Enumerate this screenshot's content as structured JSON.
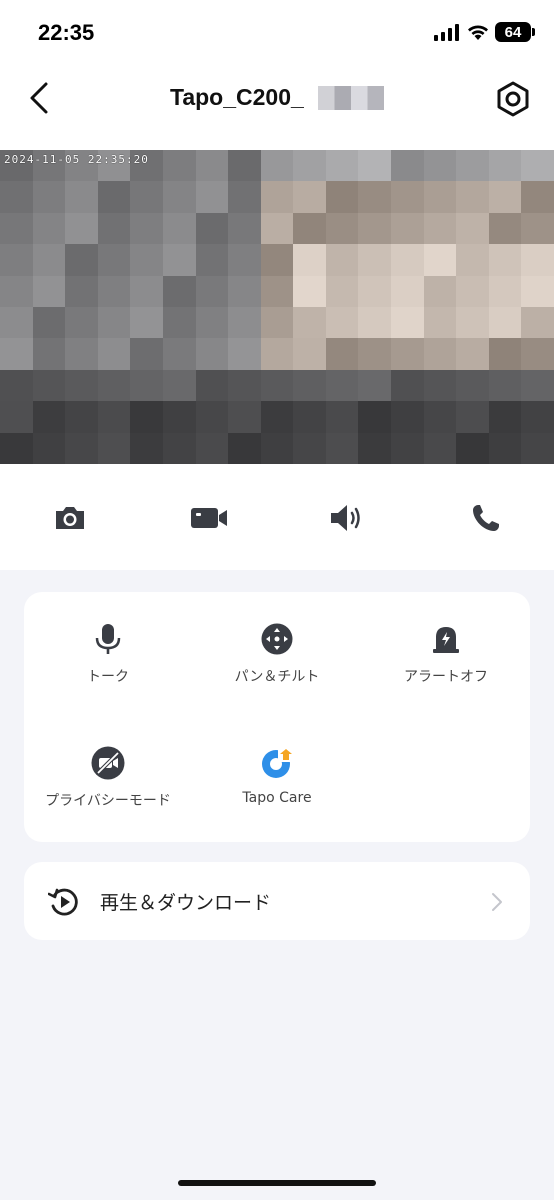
{
  "status_bar": {
    "time": "22:35",
    "battery": "64"
  },
  "header": {
    "title": "Tapo_C200_"
  },
  "video": {
    "timestamp": "2024-11-05 22:35:20"
  },
  "controls": [
    {
      "name": "snapshot",
      "icon": "camera-icon"
    },
    {
      "name": "record",
      "icon": "video-camera-icon"
    },
    {
      "name": "sound",
      "icon": "speaker-icon"
    },
    {
      "name": "call",
      "icon": "phone-icon"
    }
  ],
  "features": [
    {
      "label": "トーク",
      "icon": "microphone-icon"
    },
    {
      "label": "パン＆チルト",
      "icon": "pan-tilt-icon"
    },
    {
      "label": "アラートオフ",
      "icon": "alarm-icon"
    },
    {
      "label": "プライバシーモード",
      "icon": "privacy-mode-icon"
    },
    {
      "label": "Tapo Care",
      "icon": "tapo-care-icon"
    }
  ],
  "playback": {
    "label": "再生＆ダウンロード",
    "icon": "playback-history-icon"
  },
  "colors": {
    "accent": "#2e8fe8",
    "accent_orange": "#f5a623",
    "icon_dark": "#3a3d44",
    "background": "#f3f4f9"
  }
}
